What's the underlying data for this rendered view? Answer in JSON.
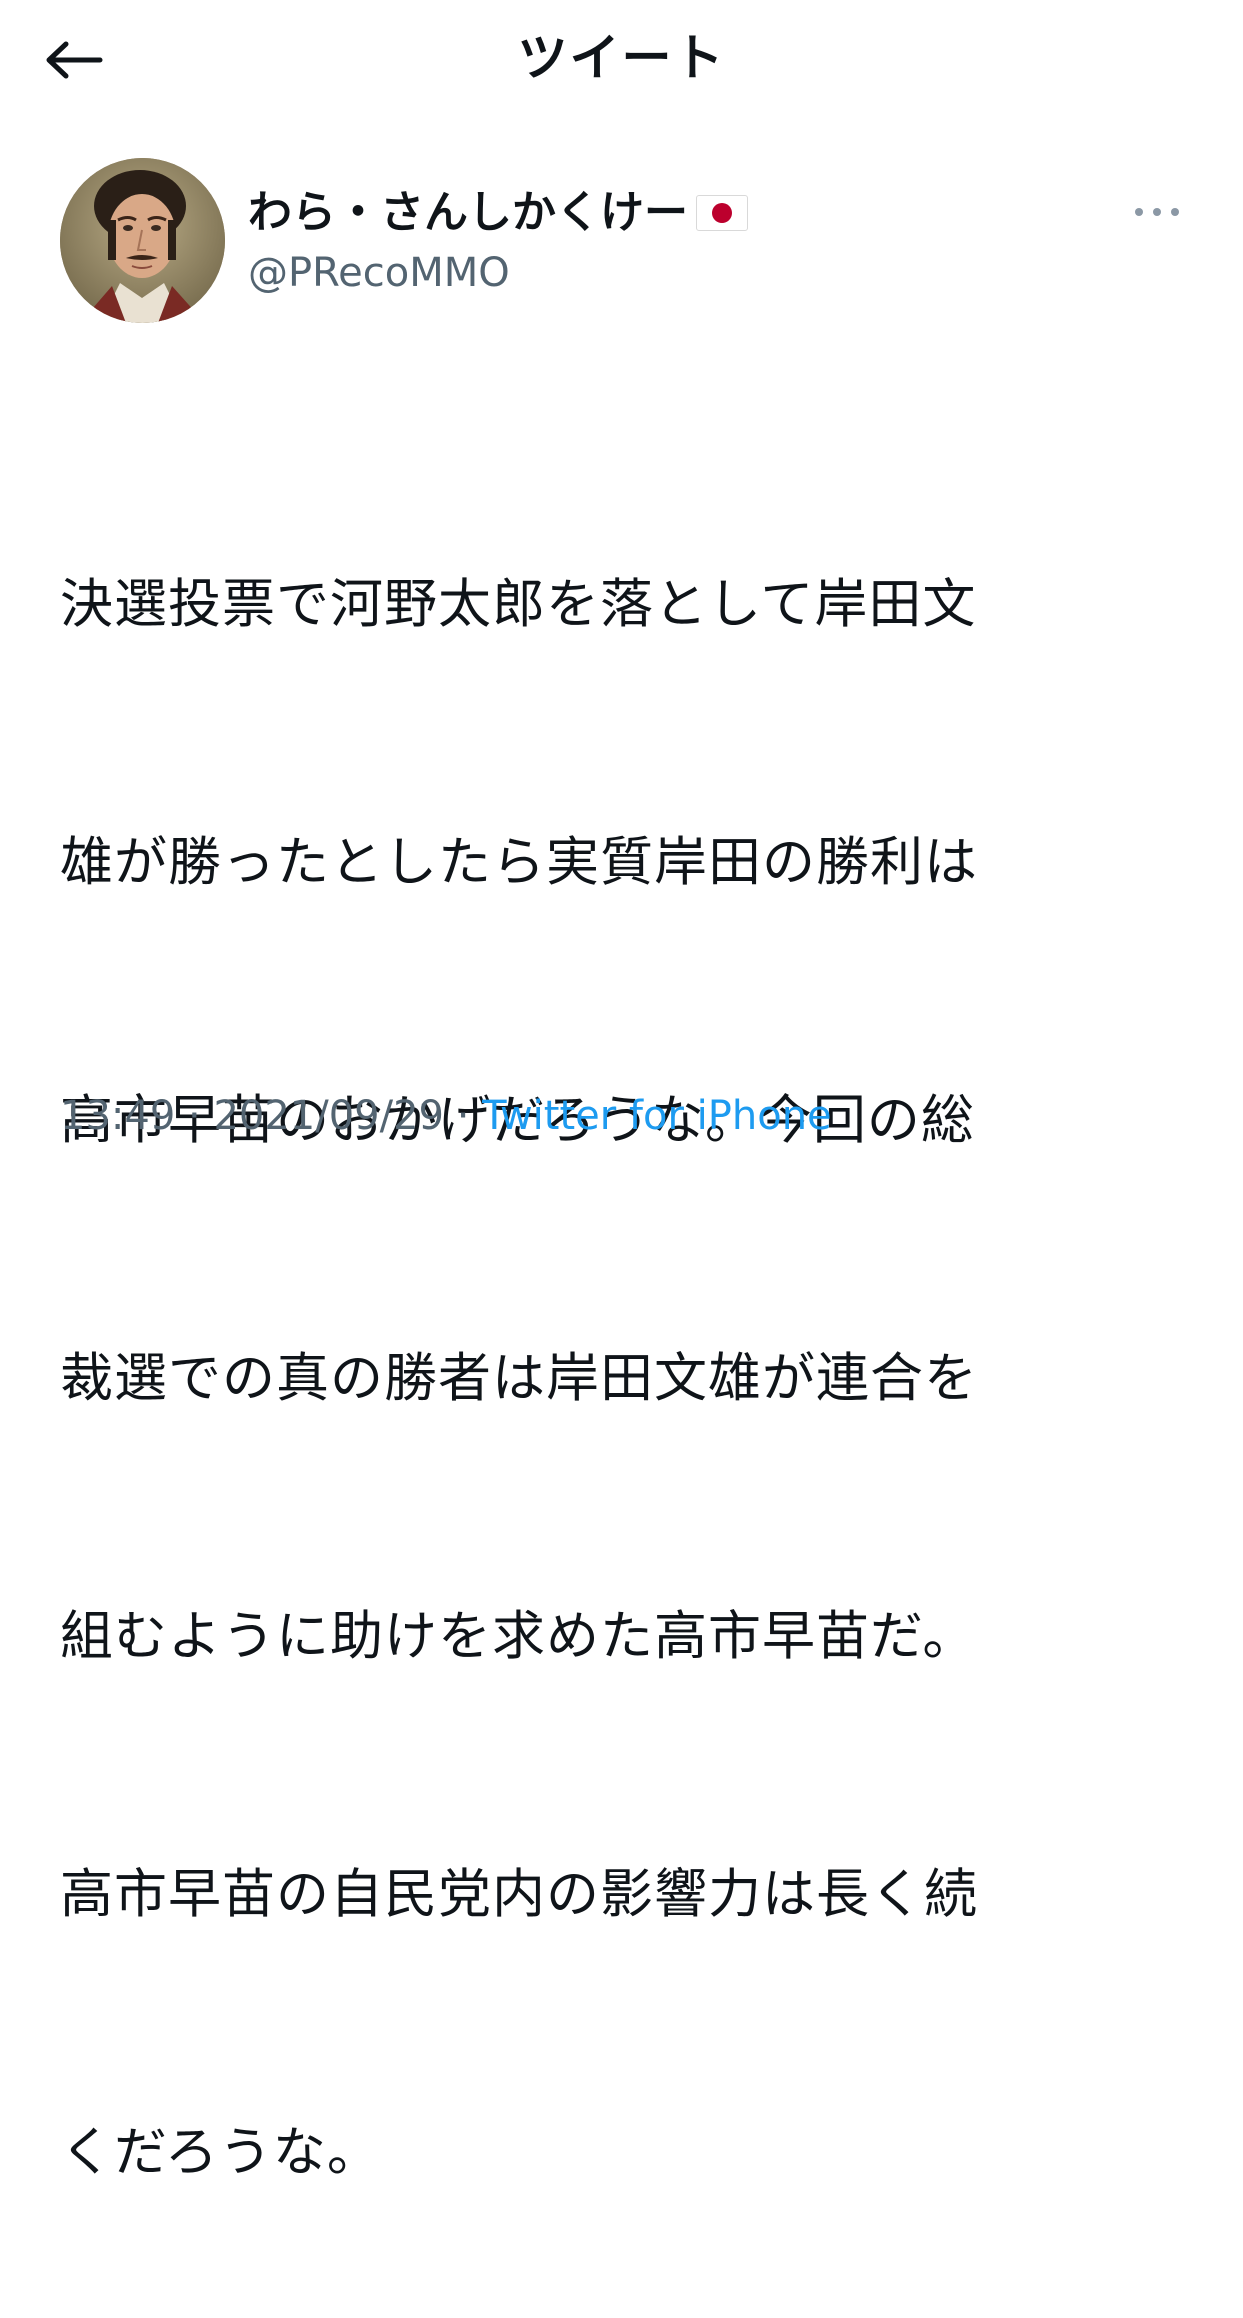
{
  "header": {
    "back_icon": "arrow-left-icon",
    "title": "ツイート"
  },
  "tweet": {
    "author": {
      "display_name": "わら・さんしかくけー",
      "flag_icon": "japan-flag-icon",
      "handle": "@PRecoMMO",
      "avatar_icon": "portrait-avatar"
    },
    "more_icon": "more-horizontal-icon",
    "text_lines": [
      "決選投票で河野太郎を落として岸田文",
      "雄が勝ったとしたら実質岸田の勝利は",
      "高市早苗のおかげだろうな。今回の総",
      "裁選での真の勝者は岸田文雄が連合を",
      "組むように助けを求めた高市早苗だ。",
      "高市早苗の自民党内の影響力は長く続",
      "くだろうな。"
    ],
    "time": "13:49",
    "separator": " · ",
    "date": "2021/09/29",
    "source": "Twitter for iPhone"
  },
  "colors": {
    "text": "#0f1419",
    "muted": "#536471",
    "link": "#1d9bf0"
  }
}
